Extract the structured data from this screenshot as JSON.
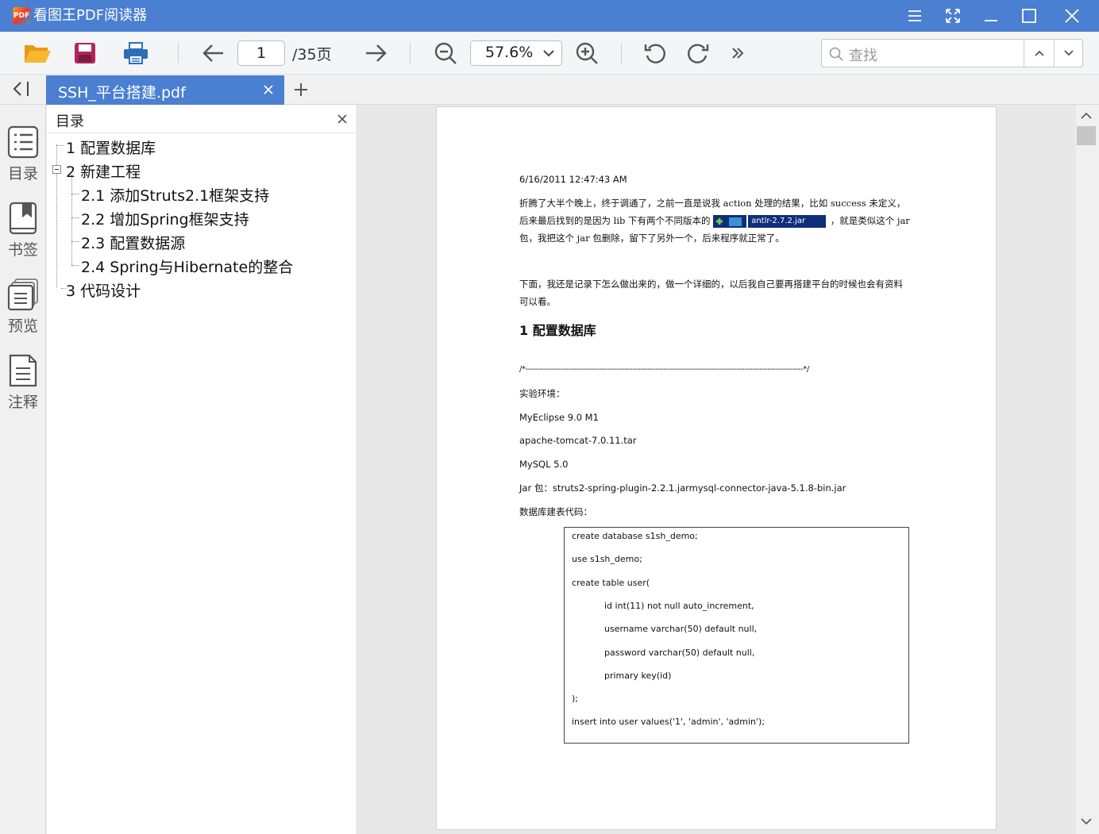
{
  "app": {
    "logo_text": "PDF",
    "title": "看图王PDF阅读器"
  },
  "toolbar": {
    "page_current": "1",
    "page_total": "/35页",
    "zoom": "57.6%",
    "search_placeholder": "查找"
  },
  "tab": {
    "label": "SSH_平台搭建.pdf"
  },
  "rail": {
    "items": [
      {
        "label": "目录",
        "icon": "toc-icon"
      },
      {
        "label": "书签",
        "icon": "bookmark-icon"
      },
      {
        "label": "预览",
        "icon": "preview-icon"
      },
      {
        "label": "注释",
        "icon": "annotation-icon"
      }
    ]
  },
  "toc": {
    "title": "目录",
    "items": [
      "1 配置数据库",
      "2 新建工程",
      "2.1 添加Struts2.1框架支持",
      "2.2 增加Spring框架支持",
      "2.3 配置数据源",
      "2.4 Spring与Hibernate的整合",
      "3 代码设计"
    ]
  },
  "document": {
    "timestamp": "6/16/2011 12:47:43 AM",
    "para1_a": "折腾了大半个晚上，终于调通了，之前一直是说我 action 处理的结果，比如 success 未定义，后来最后找到的是因为 lib 下有两个不同版本的",
    "jar_name": "antlr-2.7.2.jar",
    "para1_b": "，就是类似这个 jar 包，我把这个 jar 包删除，留下了另外一个，后来程序就正常了。",
    "para2": "下面，我还是记录下怎么做出来的，做一个详细的，以后我自己要再搭建平台的时候也会有资料可以看。",
    "heading1": "1 配置数据库",
    "divider_line": "/*-------------------------------------------------------------------------------------------------------------*/",
    "env_label": "实验环境：",
    "env_items": [
      "MyEclipse 9.0 M1",
      "apache-tomcat-7.0.11.tar",
      "MySQL 5.0",
      "Jar 包：struts2-spring-plugin-2.2.1.jarmysql-connector-java-5.1.8-bin.jar"
    ],
    "code_label": "数据库建表代码：",
    "code_lines": [
      "create database s1sh_demo;",
      "use s1sh_demo;",
      "create table user(",
      "id int(11) not null auto_increment,",
      "username varchar(50) default null,",
      "password varchar(50) default null,",
      "primary key(id)",
      ");",
      "insert into user values('1', 'admin', 'admin');"
    ]
  }
}
